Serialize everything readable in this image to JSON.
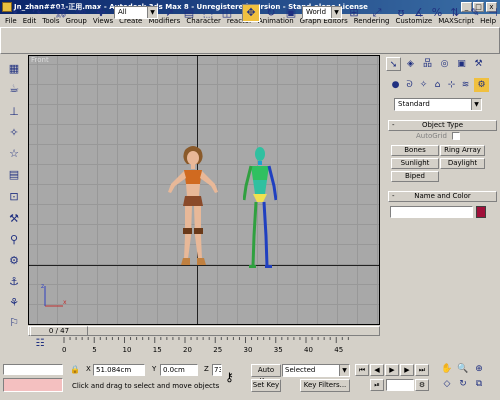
{
  "window": {
    "title": "Jn_zhan##01-正用.max - Autodesk 3ds Max 8 - Unregistered Version - Stand-alone License"
  },
  "window_buttons": {
    "minimize": "_",
    "maximize": "□",
    "close": "x"
  },
  "menu": [
    "File",
    "Edit",
    "Tools",
    "Group",
    "Views",
    "Create",
    "Modifiers",
    "Character",
    "reactor",
    "Animation",
    "Graph Editors",
    "Rendering",
    "Customize",
    "MAXScript",
    "Help"
  ],
  "toolbar": {
    "selection_filter": "All",
    "coord_system": "World"
  },
  "viewport": {
    "label": "Front"
  },
  "command_panel": {
    "category": "Standard",
    "object_type": {
      "header": "Object Type",
      "autogrid": "AutoGrid",
      "buttons": [
        "Bones",
        "Ring Array",
        "Sunlight",
        "Daylight",
        "Biped"
      ]
    },
    "name_and_color": {
      "header": "Name and Color",
      "swatch_color": "#a0103a"
    }
  },
  "time": {
    "frame": "0 / 47",
    "ticks": [
      "0",
      "5",
      "10",
      "15",
      "20",
      "25",
      "30",
      "35",
      "40",
      "45"
    ]
  },
  "status": {
    "x_label": "X",
    "x_value": "51.084cm",
    "y_label": "Y",
    "y_value": "0.0cm",
    "z_label": "Z",
    "z_value": "73",
    "auto_key": "Auto Key",
    "key_mode": "Selected",
    "set_key": "Set Key",
    "key_filters": "Key Filters...",
    "prompt": "Click and drag to select and move objects"
  },
  "colors": {
    "titlebar": "#0a246a",
    "active_tool": "#f0c040",
    "biped": "#2040c0"
  }
}
